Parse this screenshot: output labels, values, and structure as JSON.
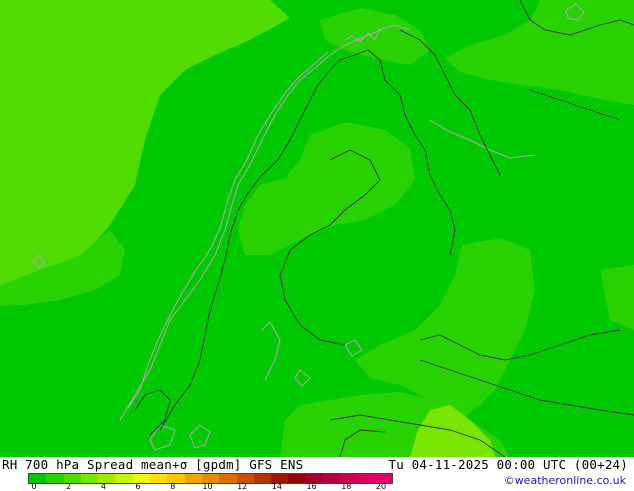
{
  "map": {
    "background_color": "#00c800",
    "mid_color": "#28d200",
    "light_color": "#50dc00",
    "lighter_color": "#78e600",
    "border_color": "#333333",
    "coast_color": "#aaaaaa"
  },
  "footer": {
    "title_left": "RH 700 hPa Spread mean+σ [gpdm] GFS ENS",
    "title_right": "Tu 04-11-2025 00:00 UTC (00+24)",
    "credit": "©weatheronline.co.uk",
    "colorbar": {
      "colors": [
        "#00c800",
        "#28d200",
        "#50dc00",
        "#78e600",
        "#a0eb00",
        "#c8f500",
        "#f0ff00",
        "#ffe100",
        "#ffc800",
        "#f0a500",
        "#e68c00",
        "#dc6e00",
        "#c85000",
        "#b43200",
        "#a01400",
        "#960000",
        "#a00028",
        "#b4003c",
        "#c80050",
        "#dc0064",
        "#e6006e"
      ],
      "tick_labels": [
        "0",
        "2",
        "4",
        "6",
        "8",
        "10",
        "12",
        "14",
        "16",
        "18",
        "20"
      ]
    }
  }
}
